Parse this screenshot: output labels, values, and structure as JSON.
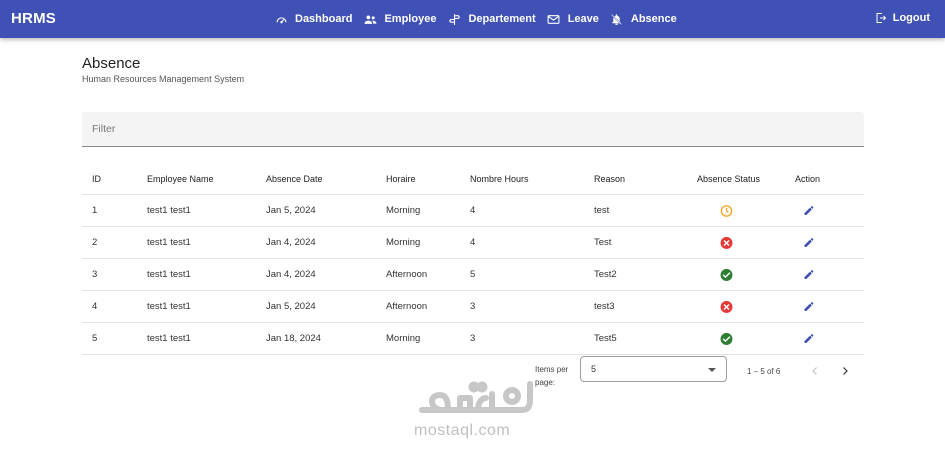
{
  "navbar": {
    "brand": "HRMS",
    "items": [
      {
        "label": "Dashboard",
        "icon": "dashboard-icon"
      },
      {
        "label": "Employee",
        "icon": "people-icon"
      },
      {
        "label": "Departement",
        "icon": "signpost-icon"
      },
      {
        "label": "Leave",
        "icon": "mail-icon"
      },
      {
        "label": "Absence",
        "icon": "bell-off-icon"
      }
    ],
    "logout": {
      "label": "Logout",
      "icon": "logout-icon"
    }
  },
  "page": {
    "title": "Absence",
    "subtitle": "Human Resources Management System"
  },
  "filter": {
    "placeholder": "Filter",
    "value": ""
  },
  "table": {
    "columns": [
      "ID",
      "Employee Name",
      "Absence Date",
      "Horaire",
      "Nombre Hours",
      "Reason",
      "Absence Status",
      "Action"
    ],
    "rows": [
      {
        "id": "1",
        "name": "test1 test1",
        "date": "Jan 5, 2024",
        "horaire": "Morning",
        "hours": "4",
        "reason": "test",
        "status": "pending"
      },
      {
        "id": "2",
        "name": "test1 test1",
        "date": "Jan 4, 2024",
        "horaire": "Morning",
        "hours": "4",
        "reason": "Test",
        "status": "rejected"
      },
      {
        "id": "3",
        "name": "test1 test1",
        "date": "Jan 4, 2024",
        "horaire": "Afternoon",
        "hours": "5",
        "reason": "Test2",
        "status": "approved"
      },
      {
        "id": "4",
        "name": "test1 test1",
        "date": "Jan 5, 2024",
        "horaire": "Afternoon",
        "hours": "3",
        "reason": "test3",
        "status": "rejected"
      },
      {
        "id": "5",
        "name": "test1 test1",
        "date": "Jan 18, 2024",
        "horaire": "Morning",
        "hours": "3",
        "reason": "Test5",
        "status": "approved"
      }
    ]
  },
  "paginator": {
    "items_per_page_label": "Items per page:",
    "page_size": "5",
    "range_label": "1 – 5 of 6"
  },
  "colors": {
    "navbar": "#3f51b5",
    "pending": "#f5a623",
    "rejected": "#e53935",
    "approved": "#2e7d32",
    "edit": "#3f51b5"
  },
  "watermark": {
    "logo_text": "مستقل",
    "text": "mostaql.com"
  }
}
